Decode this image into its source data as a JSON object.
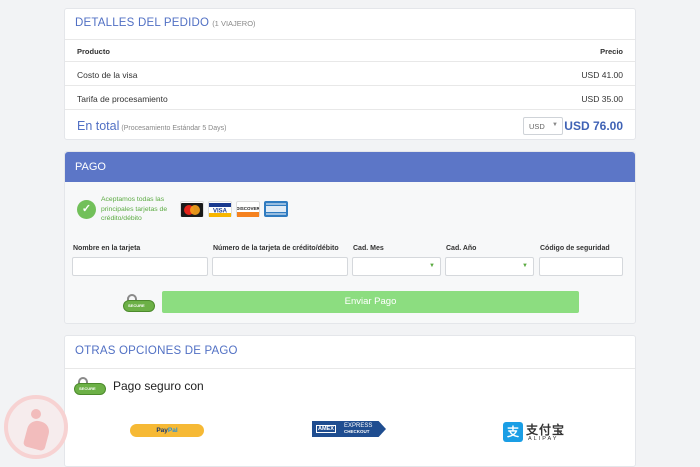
{
  "order": {
    "title": "DETALLES DEL PEDIDO",
    "subtitle": "(1 VIAJERO)",
    "header_product": "Producto",
    "header_price": "Precio",
    "items": [
      {
        "name": "Costo de la visa",
        "price": "USD 41.00"
      },
      {
        "name": "Tarifa de procesamiento",
        "price": "USD 35.00"
      }
    ],
    "total_label": "En total",
    "total_note": "(Procesamiento Estándar 5 Days)",
    "currency": "USD",
    "total_amount": "USD 76.00"
  },
  "payment": {
    "title": "PAGO",
    "accept_text": "Aceptamos todas las principales tarjetas de crédito/débito",
    "card_logos": [
      "mastercard-icon",
      "visa-icon",
      "discover-icon",
      "amex-icon"
    ],
    "fields": {
      "name": "Nombre en la tarjeta",
      "number": "Número de la tarjeta de crédito/débito",
      "month": "Cad. Mes",
      "year": "Cad. Año",
      "cvv": "Código de seguridad"
    },
    "submit_label": "Enviar Pago",
    "accent_green": "#8cdd80",
    "header_color": "#5c76c7"
  },
  "other": {
    "title": "OTRAS OPCIONES DE PAGO",
    "secure_text": "Pago seguro con",
    "paypal_a": "Pay",
    "paypal_b": "Pal",
    "amex_logo": "AMEX",
    "amex_express": "EXPRESS",
    "amex_checkout": "CHECKOUT",
    "alipay_cn": "支付宝",
    "alipay_en": "ALIPAY"
  }
}
